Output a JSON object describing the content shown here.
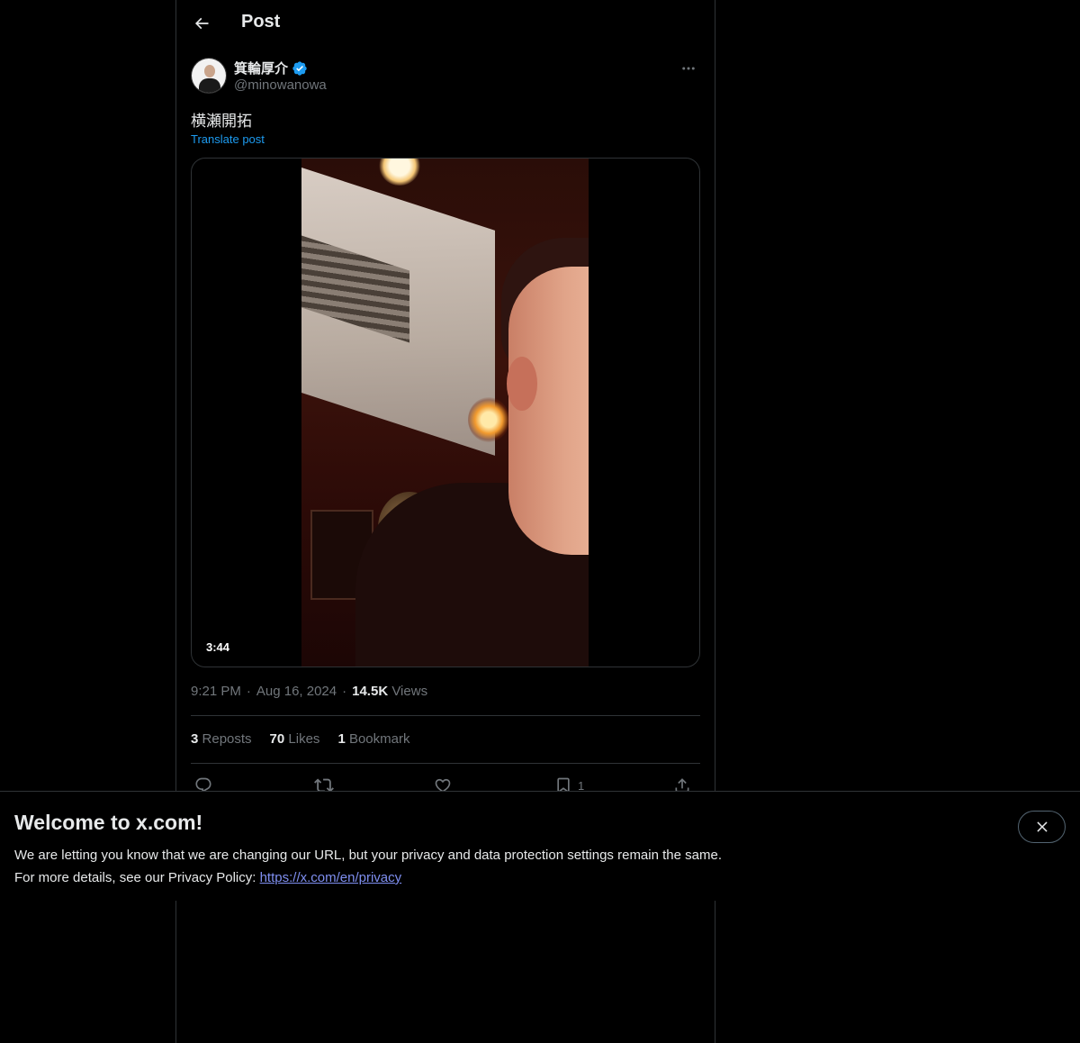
{
  "header": {
    "title": "Post",
    "back_icon": "arrow-left-icon"
  },
  "author": {
    "display_name": "箕輪厚介",
    "handle": "@minowanowa",
    "verified": true,
    "verified_color": "#1d9bf0"
  },
  "post": {
    "text": "横瀬開拓",
    "translate_label": "Translate post",
    "video_duration": "3:44",
    "time": "9:21 PM",
    "date": "Aug 16, 2024",
    "separator": "·",
    "views_count": "14.5K",
    "views_label": "Views"
  },
  "stats": {
    "reposts_count": "3",
    "reposts_label": "Reposts",
    "likes_count": "70",
    "likes_label": "Likes",
    "bookmarks_count": "1",
    "bookmarks_label": "Bookmark"
  },
  "actions": {
    "bookmark_count": "1"
  },
  "banner": {
    "title": "Welcome to x.com!",
    "line1": "We are letting you know that we are changing our URL, but your privacy and data protection settings remain the same.",
    "line2_prefix": "For more details, see our Privacy Policy: ",
    "link_text": "https://x.com/en/privacy"
  },
  "colors": {
    "background": "#000000",
    "text_primary": "#e7e9ea",
    "text_secondary": "#71767b",
    "accent": "#1d9bf0",
    "border": "#2f3336"
  }
}
